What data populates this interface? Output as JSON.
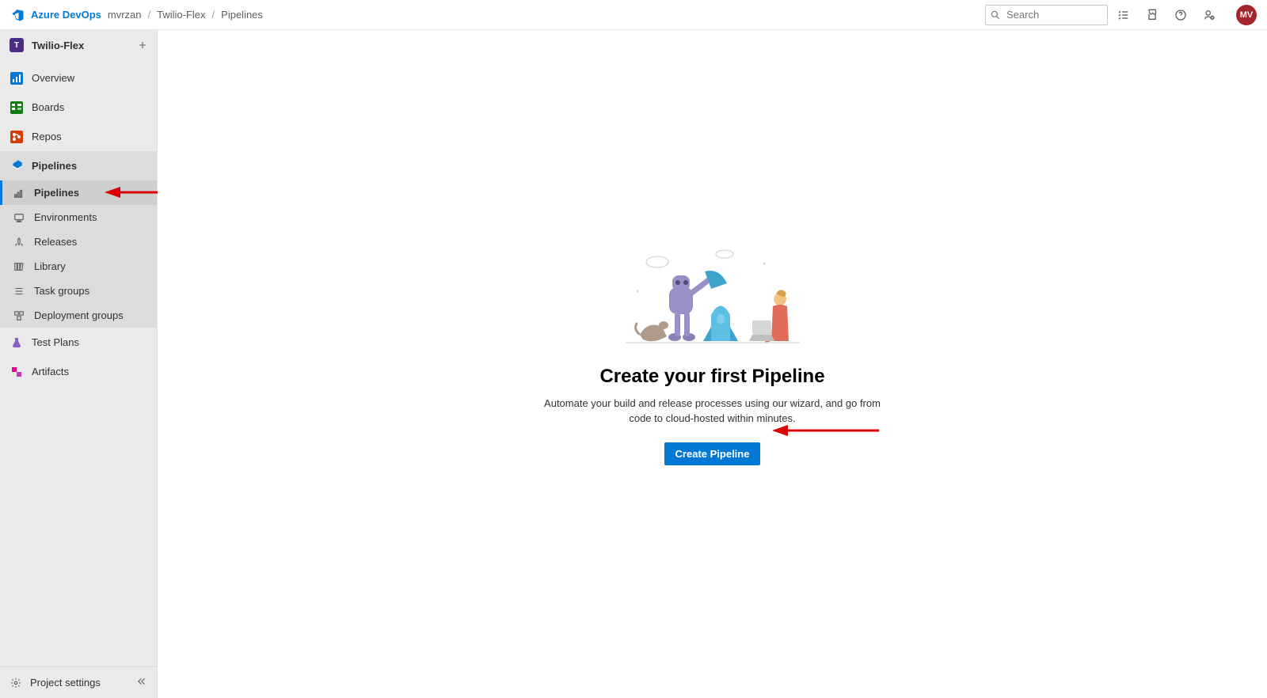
{
  "header": {
    "brand": "Azure DevOps",
    "crumbs": [
      "mvrzan",
      "Twilio-Flex",
      "Pipelines"
    ],
    "search_placeholder": "Search",
    "avatar_initials": "MV"
  },
  "sidebar": {
    "project_name": "Twilio-Flex",
    "project_initial": "T",
    "items": [
      {
        "label": "Overview",
        "icon": "overview"
      },
      {
        "label": "Boards",
        "icon": "boards"
      },
      {
        "label": "Repos",
        "icon": "repos"
      },
      {
        "label": "Pipelines",
        "icon": "pipelines",
        "active_section": true,
        "children": [
          {
            "label": "Pipelines",
            "icon": "pipelines-sub",
            "selected": true
          },
          {
            "label": "Environments",
            "icon": "environments"
          },
          {
            "label": "Releases",
            "icon": "releases"
          },
          {
            "label": "Library",
            "icon": "library"
          },
          {
            "label": "Task groups",
            "icon": "task-groups"
          },
          {
            "label": "Deployment groups",
            "icon": "deployment-groups"
          }
        ]
      },
      {
        "label": "Test Plans",
        "icon": "test-plans"
      },
      {
        "label": "Artifacts",
        "icon": "artifacts"
      }
    ],
    "footer_label": "Project settings"
  },
  "main": {
    "title": "Create your first Pipeline",
    "description": "Automate your build and release processes using our wizard, and go from code to cloud-hosted within minutes.",
    "button_label": "Create Pipeline"
  }
}
